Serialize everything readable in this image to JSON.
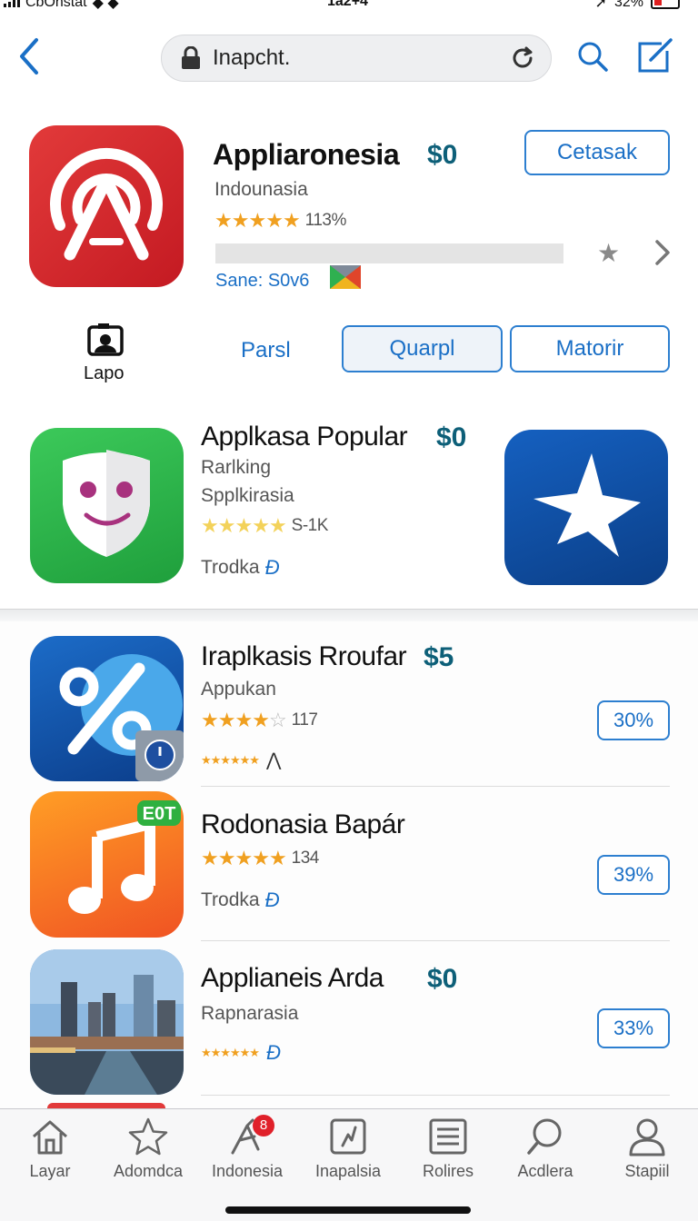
{
  "status_bar": {
    "carrier": "CbOnstat",
    "time": "1a2+4",
    "battery": "32%"
  },
  "top_bar": {
    "url": "Inapcht."
  },
  "featured": {
    "title": "Appliaronesia",
    "price": "$0",
    "button": "Cetasak",
    "subtitle": "Indounasia",
    "rating_stars": 4.5,
    "rating_text": "113%",
    "progress": 0,
    "size": "Sane: S0v6"
  },
  "tabs": {
    "camera_label": "Lapo",
    "plain": "Parsl",
    "box_1": "Quarpl",
    "box_2": "Matorir"
  },
  "popular": {
    "title": "Applkasa Popular",
    "price": "$0",
    "sub1": "Rarlking",
    "sub2": "Spplkirasia",
    "rating_stars": 4.5,
    "rating_text": "S-1K",
    "trodka": "Trodka"
  },
  "list": [
    {
      "title": "Iraplkasis Rroufar",
      "price": "$5",
      "subtitle": "Appukan",
      "rating_stars": 4,
      "rating_text": "117",
      "mini_stars": "★★★★★★",
      "button": "30%"
    },
    {
      "title": "Rodonasia  Bapár",
      "badge": "E0T",
      "rating_stars": 4.5,
      "rating_text": "134",
      "trodka": "Trodka",
      "button": "39%"
    },
    {
      "title": "Applianeis Arda",
      "price": "$0",
      "subtitle": "Rapnarasia",
      "mini_stars": "★★★★★★",
      "button": "33%"
    }
  ],
  "tab_bar": [
    {
      "label": "Layar",
      "icon": "home-icon"
    },
    {
      "label": "Adomdca",
      "icon": "star-icon"
    },
    {
      "label": "Indonesia",
      "icon": "compass-icon",
      "badge": "8"
    },
    {
      "label": "Inapalsia",
      "icon": "apps-icon"
    },
    {
      "label": "Rolires",
      "icon": "list-icon"
    },
    {
      "label": "Acdlera",
      "icon": "search-icon"
    },
    {
      "label": "Stapiil",
      "icon": "person-icon"
    }
  ],
  "colors": {
    "accent": "#1a6fc6",
    "price": "#0d5f78",
    "star": "#f0a020",
    "badge": "#e0202a"
  }
}
